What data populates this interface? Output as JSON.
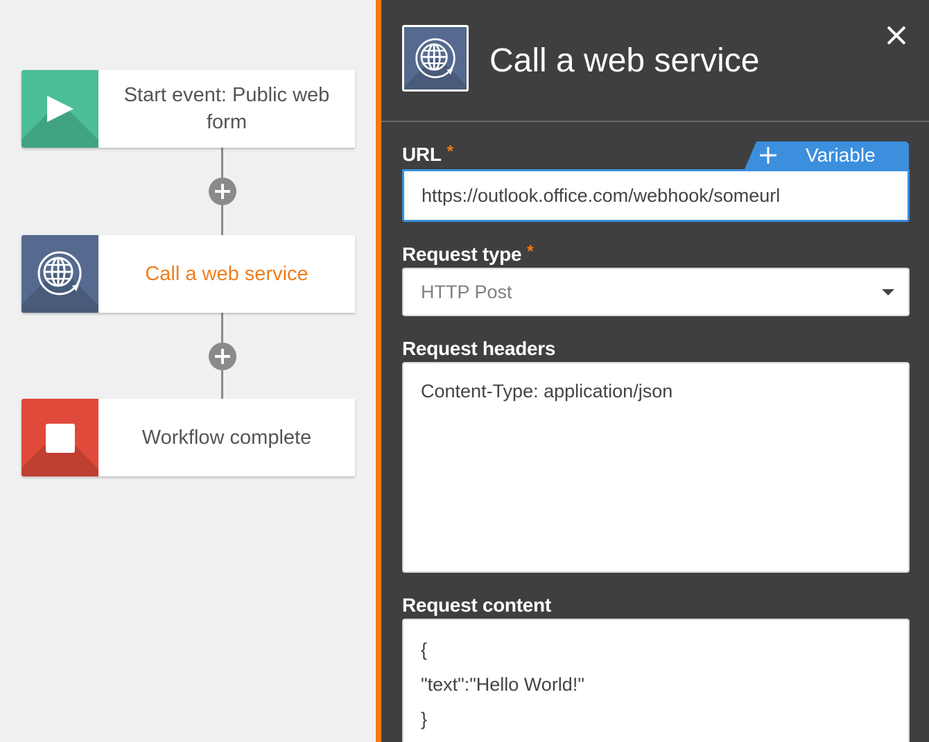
{
  "canvas": {
    "nodes": [
      {
        "label": "Start event: Public web form",
        "icon": "play-icon",
        "color": "#4cbf96"
      },
      {
        "label": "Call a web service",
        "icon": "globe-icon",
        "color": "#556a8e"
      },
      {
        "label": "Workflow complete",
        "icon": "stop-icon",
        "color": "#df4a3a"
      }
    ]
  },
  "panel": {
    "title": "Call a web service",
    "icon": "globe-icon",
    "close_icon": "close-icon",
    "url": {
      "label": "URL",
      "required": "*",
      "variable_label": "Variable",
      "value": "https://outlook.office.com/webhook/someurl"
    },
    "request_type": {
      "label": "Request type",
      "required": "*",
      "value": "HTTP Post"
    },
    "request_headers": {
      "label": "Request headers",
      "value": "Content-Type: application/json"
    },
    "request_content": {
      "label": "Request content",
      "lines": [
        "{",
        "\"text\":\"Hello World!\"",
        "}"
      ]
    }
  },
  "colors": {
    "accent_orange": "#f47b0f",
    "accent_blue": "#3b8fdd",
    "panel_bg": "#3f3f3f",
    "canvas_bg": "#f0f0f0"
  }
}
